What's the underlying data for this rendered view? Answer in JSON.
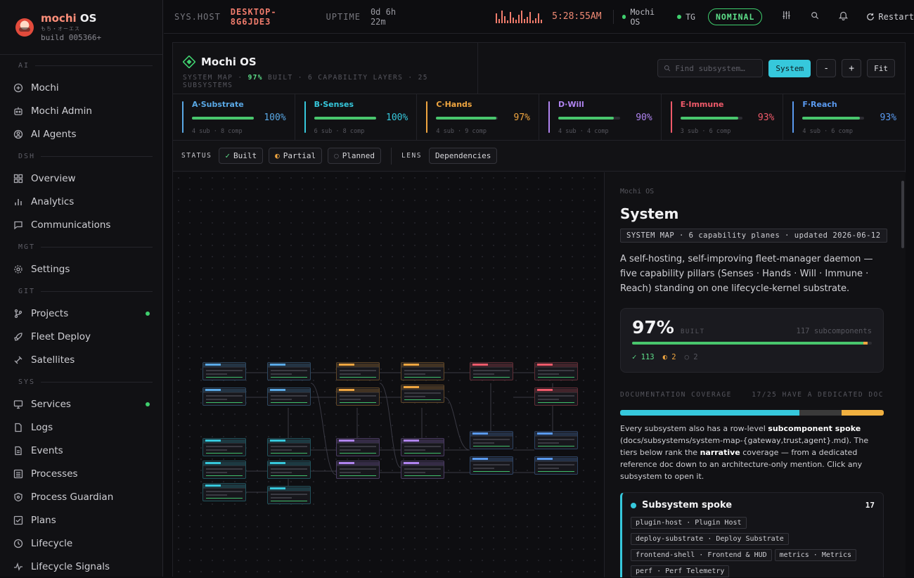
{
  "brand": {
    "title_main": "mochi",
    "title_os": "OS",
    "subtitle": "もち・オーエス",
    "build": "build 005366+"
  },
  "sidebar": {
    "sections": [
      {
        "label": "AI",
        "items": [
          {
            "label": "Mochi",
            "icon": "plus-circle-icon"
          },
          {
            "label": "Mochi Admin",
            "icon": "robot-icon"
          },
          {
            "label": "AI Agents",
            "icon": "user-icon"
          }
        ]
      },
      {
        "label": "DSH",
        "items": [
          {
            "label": "Overview",
            "icon": "grid-icon"
          },
          {
            "label": "Analytics",
            "icon": "bar-chart-icon"
          },
          {
            "label": "Communications",
            "icon": "chat-icon"
          }
        ]
      },
      {
        "label": "MGT",
        "items": [
          {
            "label": "Settings",
            "icon": "gear-icon"
          }
        ]
      },
      {
        "label": "GIT",
        "items": [
          {
            "label": "Projects",
            "icon": "branch-icon",
            "dot": true
          },
          {
            "label": "Fleet Deploy",
            "icon": "rocket-icon"
          },
          {
            "label": "Satellites",
            "icon": "satellite-icon"
          }
        ]
      },
      {
        "label": "SYS",
        "items": [
          {
            "label": "Services",
            "icon": "monitor-icon",
            "dot": true
          },
          {
            "label": "Logs",
            "icon": "file-icon"
          },
          {
            "label": "Events",
            "icon": "document-icon"
          },
          {
            "label": "Processes",
            "icon": "list-icon"
          },
          {
            "label": "Process Guardian",
            "icon": "shield-icon"
          },
          {
            "label": "Plans",
            "icon": "checklist-icon"
          },
          {
            "label": "Lifecycle",
            "icon": "clock-icon"
          },
          {
            "label": "Lifecycle Signals",
            "icon": "pulse-icon"
          }
        ]
      }
    ]
  },
  "topbar": {
    "host_label": "SYS.HOST",
    "host": "DESKTOP-8G6JDE3",
    "uptime_label": "UPTIME",
    "uptime": "0d 6h 22m",
    "time": "5:28:55AM",
    "pills": [
      "Mochi OS",
      "TG"
    ],
    "status": "NOMINAL",
    "restart": "Restart",
    "accent": "#f07c6c",
    "ok_color": "#3fcf6e"
  },
  "header": {
    "title": "Mochi OS",
    "sub_prefix": "SYSTEM MAP",
    "sub_pct": "97%",
    "sub_built": "BUILT",
    "sub_layers": "6 CAPABILITY LAYERS",
    "sub_subsystems": "25 SUBSYSTEMS",
    "search_placeholder": "Find subsystem…",
    "system_btn": "System",
    "minus": "-",
    "plus": "+",
    "fit": "Fit"
  },
  "layers": [
    {
      "name": "A·Substrate",
      "pct": "100%",
      "fill": 1.0,
      "meta": "4 sub · 8 comp",
      "color": "#5aa9e6"
    },
    {
      "name": "B·Senses",
      "pct": "100%",
      "fill": 1.0,
      "meta": "6 sub · 8 comp",
      "color": "#36c8dc"
    },
    {
      "name": "C·Hands",
      "pct": "97%",
      "fill": 0.97,
      "meta": "4 sub · 9 comp",
      "color": "#f0a640"
    },
    {
      "name": "D·Will",
      "pct": "90%",
      "fill": 0.9,
      "meta": "4 sub · 4 comp",
      "color": "#b084f0"
    },
    {
      "name": "E·Immune",
      "pct": "93%",
      "fill": 0.93,
      "meta": "3 sub · 6 comp",
      "color": "#f05a6a"
    },
    {
      "name": "F·Reach",
      "pct": "93%",
      "fill": 0.93,
      "meta": "4 sub · 6 comp",
      "color": "#5a9af0"
    }
  ],
  "filters": {
    "status_label": "STATUS",
    "built": "Built",
    "partial": "Partial",
    "planned": "Planned",
    "lens_label": "LENS",
    "lens": "Dependencies"
  },
  "panel": {
    "crumb": "Mochi OS",
    "title": "System",
    "tag": "SYSTEM MAP · 6 capability planes · updated 2026-06-12",
    "description": "A self-hosting, self-improving fleet-manager daemon — five capability pillars (Senses · Hands · Will · Immune · Reach) standing on one lifecycle-kernel substrate.",
    "pct": "97%",
    "built_label": "BUILT",
    "subcomponents": "117 subcomponents",
    "built_fraction": 0.966,
    "partial_fraction": 0.017,
    "count_built": "✓ 113",
    "count_partial": "◐ 2",
    "count_planned": "○ 2",
    "doc_label": "DOCUMENTATION COVERAGE",
    "doc_count": "17/25 HAVE A DEDICATED DOC",
    "doc_split": [
      0.68,
      0.16,
      0.16
    ],
    "para_1": "Every subsystem also has a row-level ",
    "para_b1": "subcomponent spoke",
    "para_2": " (docs/subsystems/system-map-{gateway,trust,agent}.md). The tiers below rank the ",
    "para_b2": "narrative",
    "para_3": " coverage — from a dedicated reference doc down to an architecture-only mention. Click any subsystem to open it.",
    "spoke_title": "Subsystem spoke",
    "spoke_count": "17",
    "spoke_chips": [
      "plugin-host · Plugin Host",
      "deploy-substrate · Deploy Substrate",
      "frontend-shell · Frontend & HUD",
      "metrics · Metrics",
      "perf · Perf Telemetry"
    ]
  }
}
